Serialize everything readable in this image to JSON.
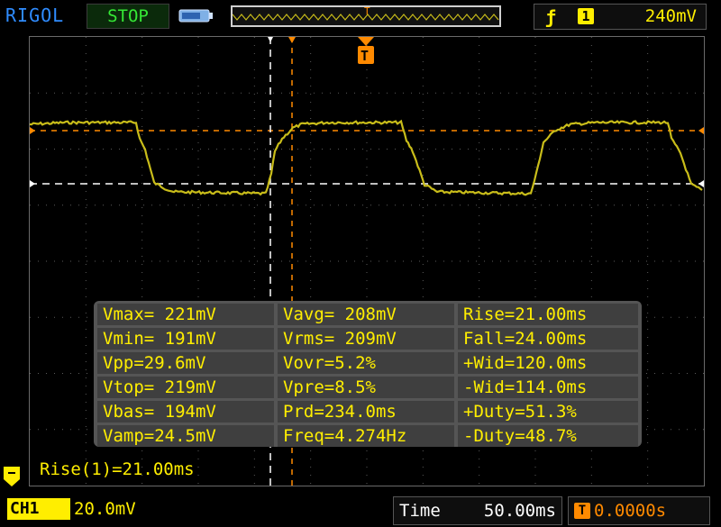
{
  "header": {
    "brand": "RIGOL",
    "run_state": "STOP",
    "trigger": {
      "edge_symbol": "ƒ",
      "channel": "1",
      "level": "240mV"
    }
  },
  "colors": {
    "trace": "#c9bd1a",
    "trigger": "#ff8a00",
    "brand": "#2f8cff",
    "run_state": "#35e835",
    "measure_text": "#ffee00"
  },
  "cursor": {
    "orange_marker": "T",
    "readout": "Rise(1)=21.00ms"
  },
  "measurements": [
    [
      "Vmax= 221mV",
      "Vavg= 208mV",
      "Rise=21.00ms"
    ],
    [
      "Vmin= 191mV",
      "Vrms= 209mV",
      "Fall=24.00ms"
    ],
    [
      "Vpp=29.6mV",
      "Vovr=5.2%",
      "+Wid=120.0ms"
    ],
    [
      "Vtop= 219mV",
      "Vpre=8.5%",
      "-Wid=114.0ms"
    ],
    [
      "Vbas= 194mV",
      "Prd=234.0ms",
      "+Duty=51.3%"
    ],
    [
      "Vamp=24.5mV",
      "Freq=4.274Hz",
      "-Duty=48.7%"
    ]
  ],
  "footer": {
    "channel_label": "CH1",
    "channel_scale": "20.0mV",
    "time_label": "Time",
    "time_value": "50.00ms",
    "trigger_offset": "0.0000s"
  }
}
